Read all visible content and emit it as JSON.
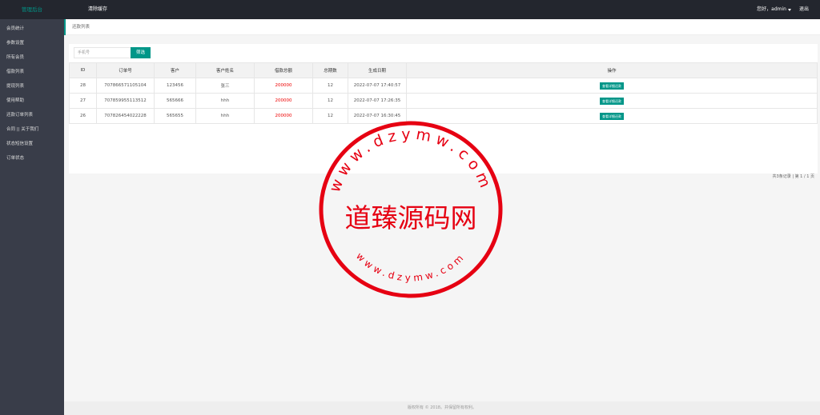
{
  "header": {
    "logo": "管理后台",
    "clear_cache": "清除缓存",
    "greeting": "您好，admin",
    "logout": "退出"
  },
  "sidebar": {
    "items": [
      {
        "label": "会员统计"
      },
      {
        "label": "参数设置"
      },
      {
        "label": "所有会员"
      },
      {
        "label": "借款列表"
      },
      {
        "label": "提现列表"
      },
      {
        "label": "使用帮助"
      },
      {
        "label": "还款订单列表"
      },
      {
        "label": "合同 || 关于我们"
      },
      {
        "label": "状态短信设置"
      },
      {
        "label": "订单状态"
      }
    ]
  },
  "tab": {
    "label": "还款列表"
  },
  "search": {
    "placeholder": "手机号",
    "button": "筛选"
  },
  "table": {
    "headers": [
      "ID",
      "订单号",
      "客户",
      "客户姓名",
      "借款总额",
      "总期数",
      "生成日期",
      "操作"
    ],
    "rows": [
      {
        "id": "28",
        "order": "7078665711051​04",
        "customer": "123456",
        "name": "张三",
        "amount": "200000",
        "periods": "12",
        "date": "2022-07-07 17:40:57",
        "action": "查看详细还款"
      },
      {
        "id": "27",
        "order": "707859955113512",
        "customer": "565666",
        "name": "hhh",
        "amount": "200000",
        "periods": "12",
        "date": "2022-07-07 17:26:35",
        "action": "查看详细还款"
      },
      {
        "id": "26",
        "order": "707826454022228",
        "customer": "565655",
        "name": "hhh",
        "amount": "200000",
        "periods": "12",
        "date": "2022-07-07 16:30:45",
        "action": "查看详细还款"
      }
    ]
  },
  "pager": {
    "text": "共3条记录 | 第 1 / 1 页"
  },
  "footer": {
    "text": "版权所有 © 2018。并保留所有权利。"
  },
  "watermark": {
    "center_text": "道臻源码网",
    "top_arc": "www.dzymw.com",
    "bottom_arc": "www.dzymw.com",
    "color": "#e60012"
  }
}
